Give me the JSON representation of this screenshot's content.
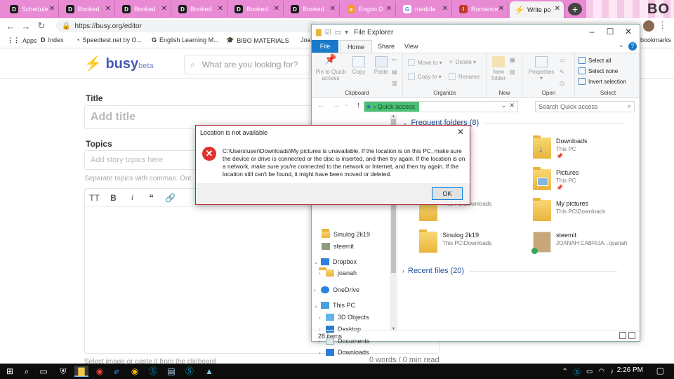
{
  "browser": {
    "tabs": [
      {
        "title": "Schedule",
        "icon": "D"
      },
      {
        "title": "Booked",
        "icon": "D"
      },
      {
        "title": "Booked",
        "icon": "D"
      },
      {
        "title": "Booked",
        "icon": "D"
      },
      {
        "title": "Booked",
        "icon": "D"
      },
      {
        "title": "Booked",
        "icon": "D"
      },
      {
        "title": "Engoo D",
        "icon": "e"
      },
      {
        "title": "meddle",
        "icon": "G"
      },
      {
        "title": "Romance",
        "icon": "/"
      },
      {
        "title": "Write po",
        "icon": "⚡"
      }
    ],
    "new_tab": "+",
    "deco_text": "BO",
    "url": "https://busy.org/editor",
    "bookmarks": [
      {
        "icon": "⋮⋮",
        "label": "Apps"
      },
      {
        "icon": "D",
        "label": "Index"
      },
      {
        "icon": "◔",
        "label": "Speedtest.net by O..."
      },
      {
        "icon": "G",
        "label": "English Learning M..."
      },
      {
        "icon": "🎓",
        "label": "BIBO MATERIALS"
      },
      {
        "icon": "",
        "label": "Joa"
      }
    ],
    "bookmarks_right": "bookmarks"
  },
  "busy": {
    "logo": "busy",
    "logo_suffix": "beta",
    "search_placeholder": "What are you looking for?",
    "title_label": "Title",
    "title_placeholder": "Add title",
    "topics_label": "Topics",
    "topics_placeholder": "Add story topics here",
    "topics_hint": "Separate topics with commas. Ont",
    "toolbar": [
      "TT",
      "B",
      "i",
      "❝",
      "🔗"
    ],
    "image_note": "Select image or paste it from the clipboard",
    "word_count": "0 words / 0 min read"
  },
  "explorer": {
    "title": "File Explorer",
    "tabs": {
      "file": "File",
      "home": "Home",
      "share": "Share",
      "view": "View"
    },
    "ribbon": {
      "clipboard": {
        "name": "Clipboard",
        "pin": "Pin to Quick access",
        "copy": "Copy",
        "paste": "Paste"
      },
      "organize": {
        "name": "Organize",
        "move_to": "Move to",
        "copy_to": "Copy to",
        "delete": "Delete",
        "rename": "Rename"
      },
      "new": {
        "name": "New",
        "new_folder": "New folder"
      },
      "open": {
        "name": "Open",
        "properties": "Properties"
      },
      "select": {
        "name": "Select",
        "select_all": "Select all",
        "select_none": "Select none",
        "invert": "Invert selection"
      }
    },
    "path": "Quick access",
    "search_placeholder": "Search Quick access",
    "nav": [
      {
        "label": "Sinulog 2k19",
        "arrow": ""
      },
      {
        "label": "steemit",
        "arrow": ""
      },
      {
        "label": "Dropbox",
        "arrow": "⌄"
      },
      {
        "label": "joanah",
        "arrow": "›"
      },
      {
        "label": "OneDrive",
        "arrow": "›"
      },
      {
        "label": "This PC",
        "arrow": "⌄"
      },
      {
        "label": "3D Objects",
        "arrow": "›"
      },
      {
        "label": "Desktop",
        "arrow": "›"
      },
      {
        "label": "Documents",
        "arrow": "›"
      },
      {
        "label": "Downloads",
        "arrow": "›"
      }
    ],
    "frequent_header": "Frequent folders (8)",
    "recent_header": "Recent files (20)",
    "tiles": [
      {
        "name": "Downloads",
        "sub": "This PC",
        "pin": "📌"
      },
      {
        "name": "Pictures",
        "sub": "This PC",
        "pin": "📌"
      },
      {
        "name": "",
        "sub": "This PC\\Downloads"
      },
      {
        "name": "My pictures",
        "sub": "This PC\\Downloads"
      },
      {
        "name": "Sinulog 2k19",
        "sub": "This PC\\Downloads"
      },
      {
        "name": "steemit",
        "sub": "JOANAH CABRIJA...\\joanah"
      }
    ],
    "status": "28 items"
  },
  "dialog": {
    "title": "Location is not available",
    "message": "C:\\Users\\user\\Downloads\\My pictures is unavailable. If the location is on this PC, make sure the device or drive is connected or the disc is inserted, and then try again. If the location is on a network, make sure you're connected to the network or Internet, and then try again. If the location still can't be found, it might have been moved or deleted.",
    "ok": "OK"
  },
  "taskbar": {
    "time": "2:26 PM"
  }
}
